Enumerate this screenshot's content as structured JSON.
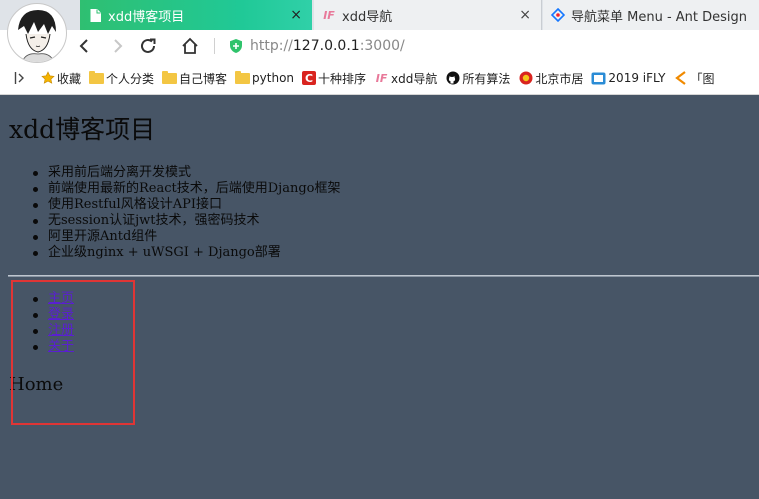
{
  "browser": {
    "tabs": [
      {
        "label": "xdd博客项目",
        "icon": "page-icon",
        "active": true
      },
      {
        "label": "xdd导航",
        "icon": "xdd-logo-icon",
        "active": false
      },
      {
        "label": "导航菜单 Menu - Ant Design",
        "icon": "ant-design-logo-icon",
        "active": false
      }
    ],
    "close_glyph": "×",
    "url": {
      "scheme": "http://",
      "host": "127.0.0.1",
      "port": ":3000/"
    },
    "bookmarks": [
      {
        "label": "收藏",
        "icon": "star-icon"
      },
      {
        "label": "个人分类",
        "icon": "folder-icon"
      },
      {
        "label": "自己博客",
        "icon": "folder-icon"
      },
      {
        "label": "python",
        "icon": "folder-icon"
      },
      {
        "label": "十种排序",
        "icon": "red-c-logo-icon"
      },
      {
        "label": "xdd导航",
        "icon": "xdd-logo-icon"
      },
      {
        "label": "所有算法",
        "icon": "github-icon"
      },
      {
        "label": "北京市居",
        "icon": "gov-emblem-icon"
      },
      {
        "label": "2019 iFLY",
        "icon": "ifly-logo-icon"
      },
      {
        "label": "「图",
        "icon": "pointer-logo-icon"
      }
    ],
    "colors": {
      "active_tab": "#20c997",
      "page_bg": "#475566",
      "link": "#5a1fd1",
      "highlight_box": "#e03535"
    }
  },
  "page": {
    "title": "xdd博客项目",
    "features": [
      "采用前后端分离开发模式",
      "前端使用最新的React技术，后端使用Django框架",
      "使用Restful风格设计API接口",
      "无session认证jwt技术，强密码技术",
      "阿里开源Antd组件",
      "企业级nginx + uWSGI + Django部署"
    ],
    "nav_links": [
      "主页",
      "登录",
      "注册",
      "关于"
    ],
    "route_heading": "Home"
  }
}
